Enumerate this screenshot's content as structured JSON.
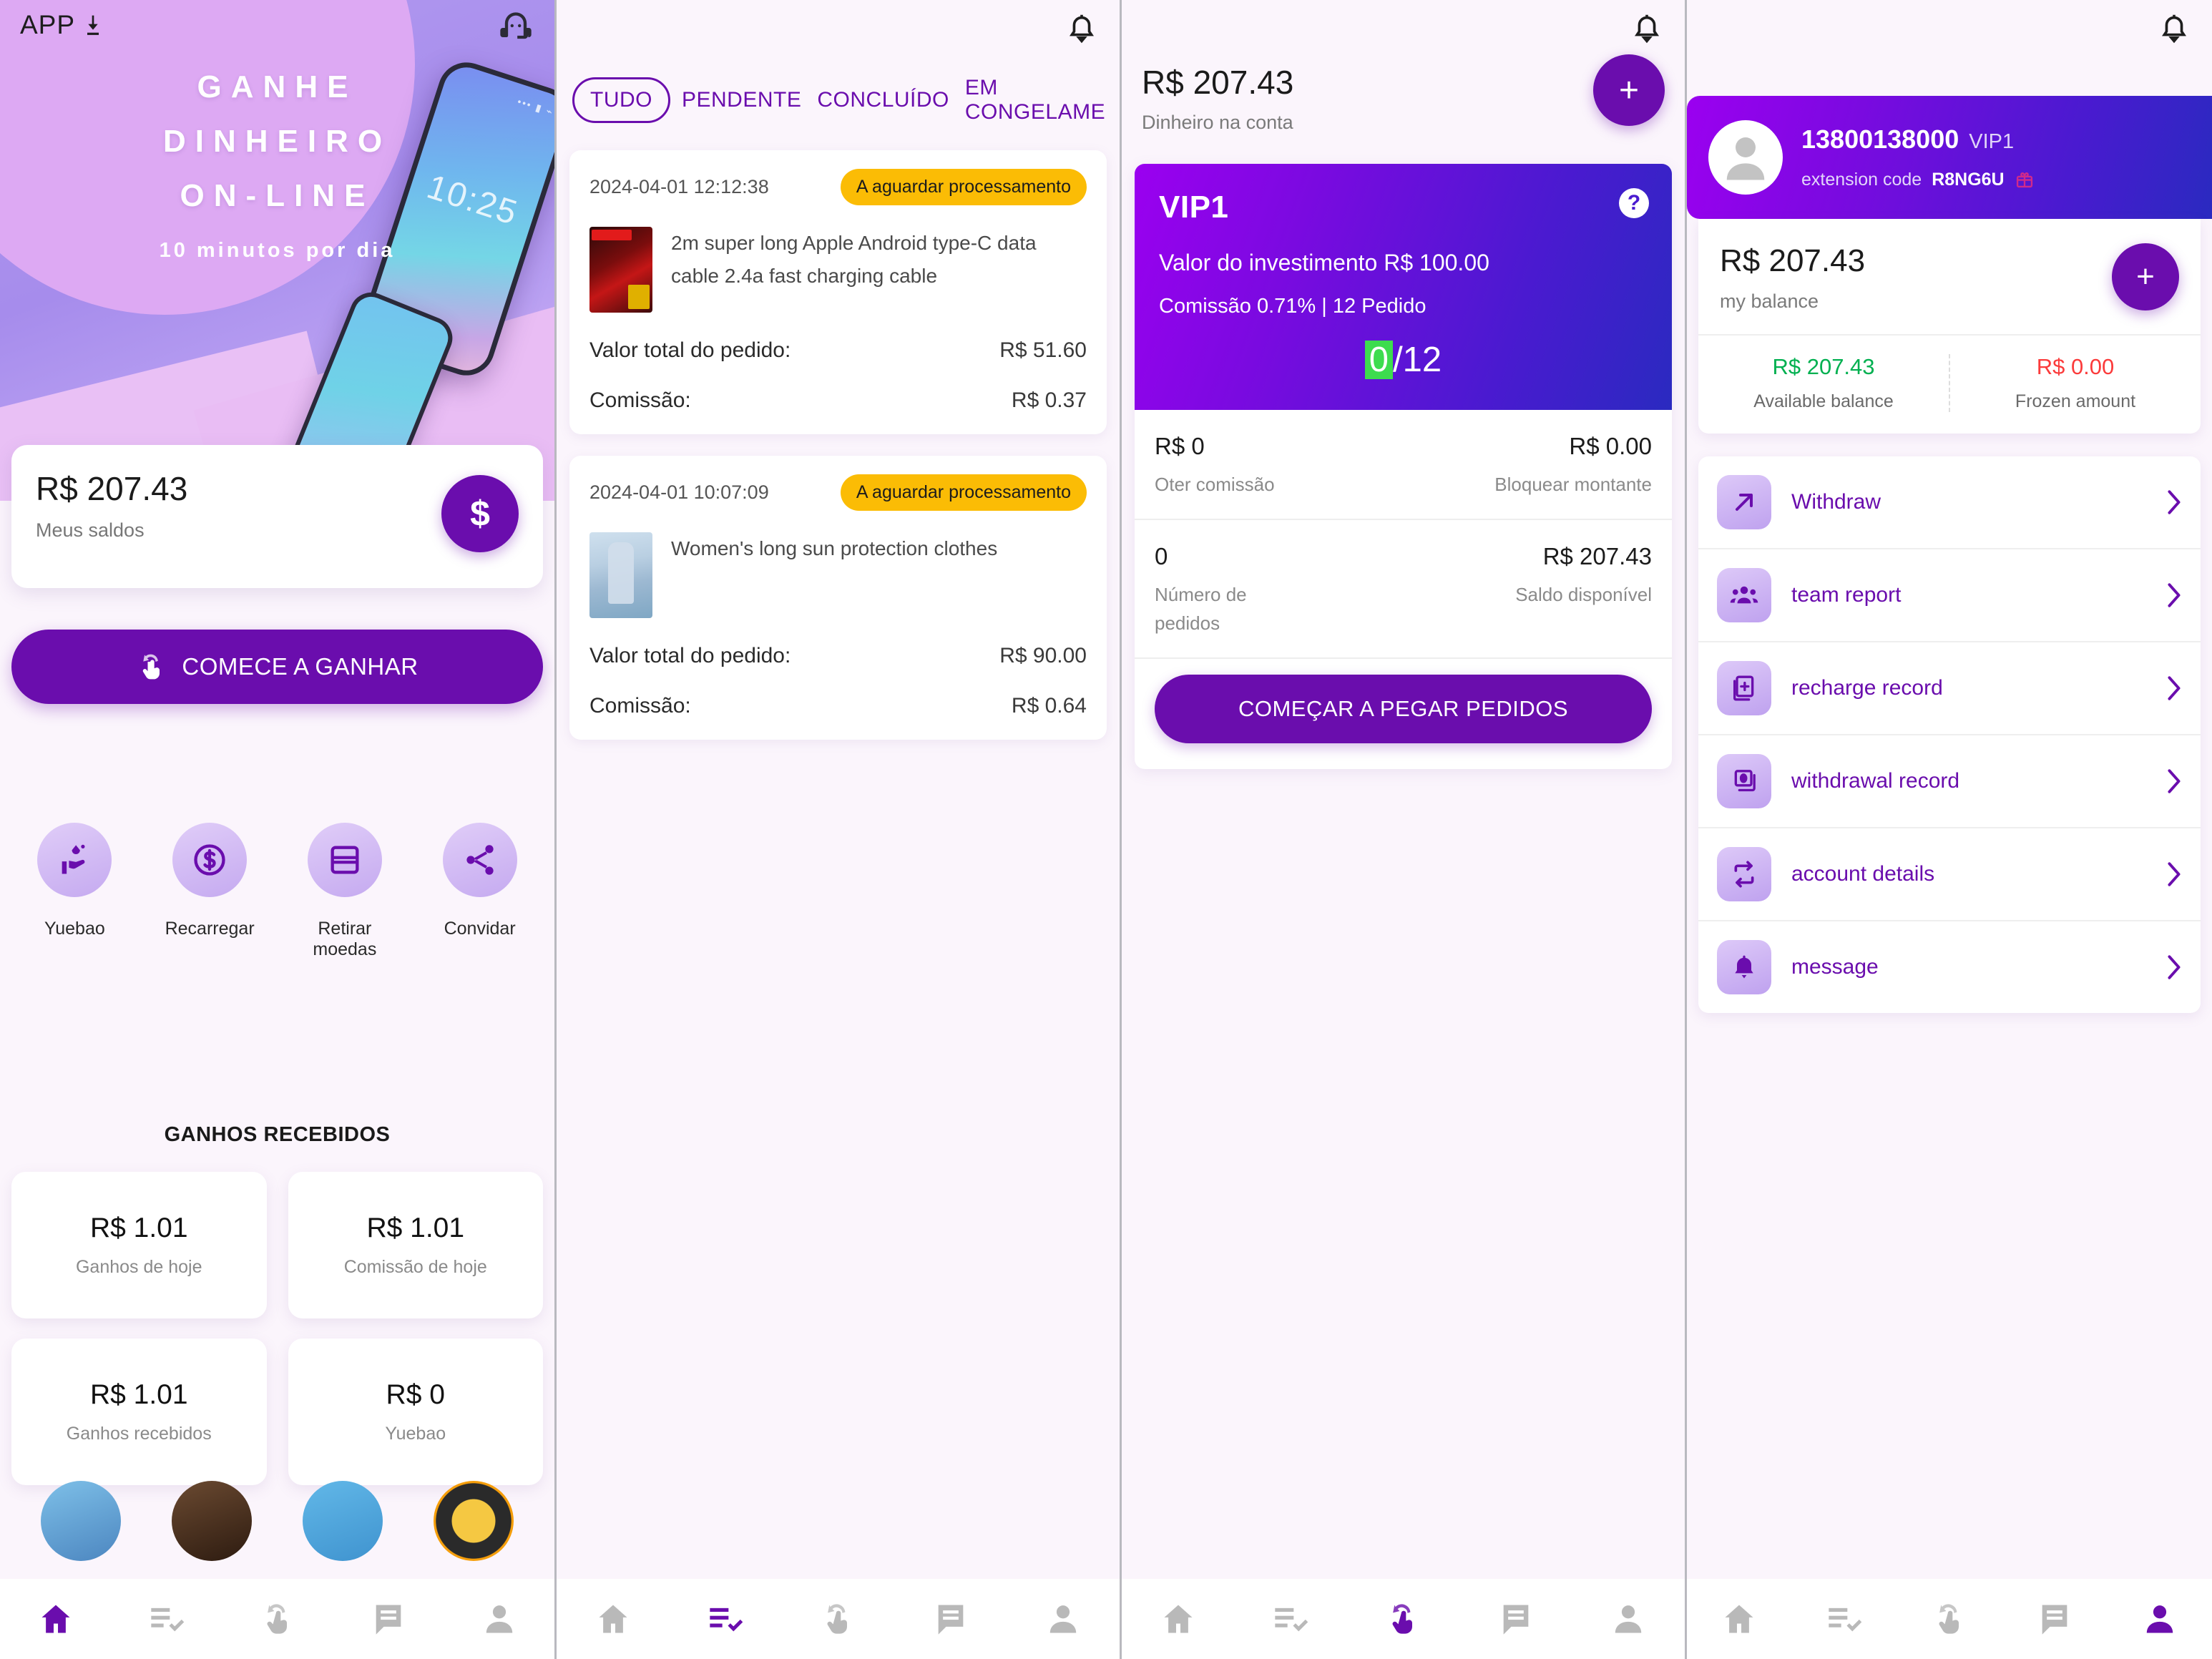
{
  "colors": {
    "primary": "#6a0dad",
    "accent_violet": "#9b00f0",
    "accent_blue": "#2a2ac0",
    "status_yellow": "#fbbc05",
    "green": "#00b050",
    "red": "#fb3b3b",
    "progress_green": "#3ddc4e"
  },
  "home": {
    "app_label": "APP",
    "hero": {
      "line1": "GANHE",
      "line2": "DINHEIRO",
      "line3": "ON-LINE",
      "line4": "10 minutos por dia",
      "phone_time": "10:25",
      "phone_status": "••• ▮ ⌁"
    },
    "balance": {
      "amount": "R$ 207.43",
      "label": "Meus saldos",
      "fab_symbol": "$"
    },
    "cta": "COMECE A GANHAR",
    "quick_actions": [
      {
        "label": "Yuebao",
        "icon": "money-hand-icon"
      },
      {
        "label": "Recarregar",
        "icon": "dollar-coin-icon"
      },
      {
        "label": "Retirar moedas",
        "icon": "card-icon"
      },
      {
        "label": "Convidar",
        "icon": "share-icon"
      }
    ],
    "earnings_title": "GANHOS RECEBIDOS",
    "earnings": [
      {
        "value": "R$ 1.01",
        "label": "Ganhos de hoje"
      },
      {
        "value": "R$ 1.01",
        "label": "Comissão de hoje"
      },
      {
        "value": "R$ 1.01",
        "label": "Ganhos recebidos"
      },
      {
        "value": "R$ 0",
        "label": "Yuebao"
      }
    ]
  },
  "orders": {
    "tabs": [
      {
        "label": "TUDO",
        "active": true
      },
      {
        "label": "PENDENTE",
        "active": false
      },
      {
        "label": "CONCLUÍDO",
        "active": false
      },
      {
        "label": "EM CONGELAME",
        "active": false
      }
    ],
    "items": [
      {
        "date": "2024-04-01 12:12:38",
        "status": "A aguardar processamento",
        "title": "2m super long Apple Android type-C data cable 2.4a fast charging cable",
        "total_label": "Valor total do pedido:",
        "total_value": "R$ 51.60",
        "commission_label": "Comissão:",
        "commission_value": "R$ 0.37"
      },
      {
        "date": "2024-04-01 10:07:09",
        "status": "A aguardar processamento",
        "title": "Women's long sun protection clothes",
        "total_label": "Valor total do pedido:",
        "total_value": "R$ 90.00",
        "commission_label": "Comissão:",
        "commission_value": "R$ 0.64"
      }
    ]
  },
  "grab": {
    "account_amount": "R$ 207.43",
    "account_label": "Dinheiro na conta",
    "fab_symbol": "+",
    "vip": {
      "name": "VIP1",
      "investment": "Valor do investimento R$ 100.00",
      "commission": "Comissão 0.71% | 12 Pedido",
      "progress_done": "0",
      "progress_total": "/12",
      "help_symbol": "?"
    },
    "stats": [
      {
        "value": "R$ 0",
        "label": "Oter comissão"
      },
      {
        "value": "R$ 0.00",
        "label": "Bloquear montante"
      },
      {
        "value": "0",
        "label": "Número de pedidos"
      },
      {
        "value": "R$ 207.43",
        "label": "Saldo disponível"
      }
    ],
    "cta": "COMEÇAR A PEGAR PEDIDOS"
  },
  "mine": {
    "profile": {
      "phone": "13800138000",
      "vip": "VIP1",
      "code_label": "extension code",
      "code_value": "R8NG6U"
    },
    "balance": {
      "amount": "R$ 207.43",
      "label": "my balance",
      "fab_symbol": "+",
      "available_value": "R$ 207.43",
      "available_label": "Available balance",
      "frozen_value": "R$ 0.00",
      "frozen_label": "Frozen amount"
    },
    "menu": [
      {
        "label": "Withdraw",
        "icon": "arrow-up-right-icon"
      },
      {
        "label": "team report",
        "icon": "group-people-icon"
      },
      {
        "label": "recharge record",
        "icon": "document-plus-icon"
      },
      {
        "label": "withdrawal record",
        "icon": "card-stack-icon"
      },
      {
        "label": "account details",
        "icon": "repeat-icon"
      },
      {
        "label": "message",
        "icon": "bell-icon"
      }
    ]
  },
  "bottom_nav": {
    "items": [
      {
        "name": "home",
        "icon": "home-icon"
      },
      {
        "name": "orders",
        "icon": "list-check-icon"
      },
      {
        "name": "grab",
        "icon": "tap-hand-icon"
      },
      {
        "name": "chat",
        "icon": "chat-icon"
      },
      {
        "name": "profile",
        "icon": "person-icon"
      }
    ],
    "active_index": {
      "home": 0,
      "orders": 1,
      "grab": 2,
      "mine": 4
    }
  }
}
